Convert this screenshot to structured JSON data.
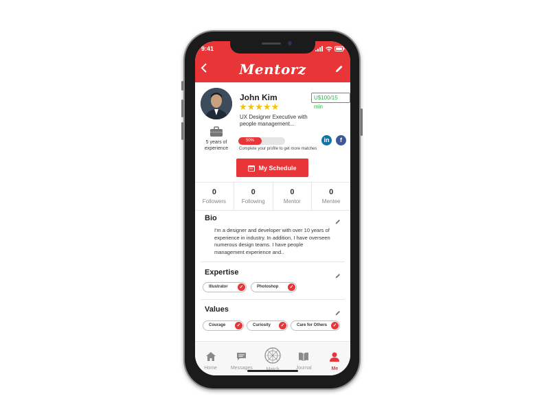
{
  "status": {
    "time": "9:41"
  },
  "header": {
    "logo": "Mentorz"
  },
  "profile": {
    "name": "John Kim",
    "stars": "★★★★★",
    "rating": 5,
    "rate": "U$100/15 min",
    "title": "UX Designer Executive with people management...",
    "experience": "5 years of experience",
    "progress_value": 0.5,
    "progress_label": "50%",
    "progress_hint": "Complete your profile to get more matches",
    "linkedin_icon": "in",
    "facebook_icon": "f"
  },
  "schedule": {
    "label": "My Schedule"
  },
  "stats": [
    {
      "count": "0",
      "label": "Followers"
    },
    {
      "count": "0",
      "label": "Following"
    },
    {
      "count": "0",
      "label": "Mentor"
    },
    {
      "count": "0",
      "label": "Mentee"
    }
  ],
  "bio": {
    "title": "Bio",
    "text": "I'm a designer and developer with over 10 years of experience in industry. In addition, I have overseen numerous design teams. I have people management experience and.."
  },
  "expertise": {
    "title": "Expertise",
    "items": [
      "Illustrator",
      "Photoshop"
    ]
  },
  "values": {
    "title": "Values",
    "items": [
      "Courage",
      "Curiosity",
      "Care for Others"
    ]
  },
  "tabs": [
    {
      "label": "Home",
      "icon": "home-icon"
    },
    {
      "label": "Messages",
      "icon": "messages-icon"
    },
    {
      "label": "Match",
      "icon": "match-icon"
    },
    {
      "label": "Journal",
      "icon": "journal-icon"
    },
    {
      "label": "Me",
      "icon": "person-icon"
    }
  ],
  "colors": {
    "accent": "#e73538",
    "star": "#f6c100",
    "rate_green": "#2fb34a"
  }
}
